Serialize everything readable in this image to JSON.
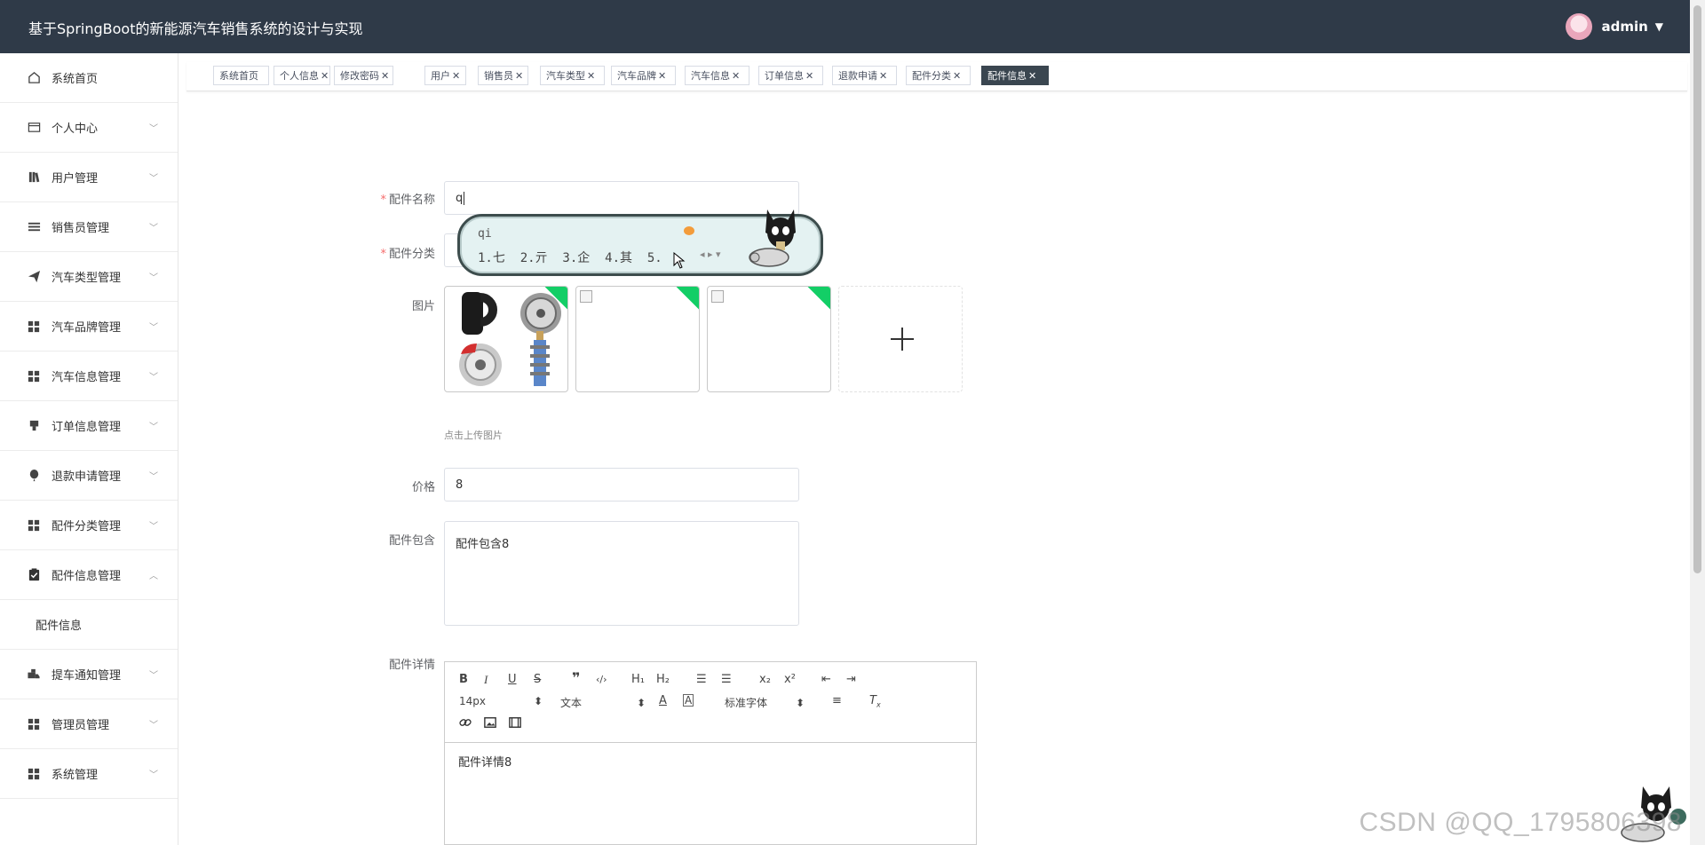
{
  "header": {
    "app_title": "基于SpringBoot的新能源汽车销售系统的设计与实现",
    "username": "admin"
  },
  "sidebar": {
    "items": [
      {
        "label": "系统首页",
        "icon": "home-icon"
      },
      {
        "label": "个人中心",
        "icon": "card-icon"
      },
      {
        "label": "用户管理",
        "icon": "users-book-icon"
      },
      {
        "label": "销售员管理",
        "icon": "list-icon"
      },
      {
        "label": "汽车类型管理",
        "icon": "send-icon"
      },
      {
        "label": "汽车品牌管理",
        "icon": "grid-icon"
      },
      {
        "label": "汽车信息管理",
        "icon": "grid-icon"
      },
      {
        "label": "订单信息管理",
        "icon": "stamp-icon"
      },
      {
        "label": "退款申请管理",
        "icon": "balloon-icon"
      },
      {
        "label": "配件分类管理",
        "icon": "grid-icon"
      },
      {
        "label": "配件信息管理",
        "icon": "clipboard-check-icon"
      },
      {
        "label": "提车通知管理",
        "icon": "truck-icon"
      },
      {
        "label": "管理员管理",
        "icon": "grid-icon"
      },
      {
        "label": "系统管理",
        "icon": "grid-icon"
      }
    ],
    "sub_item": "配件信息"
  },
  "tabs": [
    {
      "label": "系统首页"
    },
    {
      "label": "个人信息"
    },
    {
      "label": "修改密码"
    },
    {
      "label": "用户"
    },
    {
      "label": "销售员"
    },
    {
      "label": "汽车类型"
    },
    {
      "label": "汽车品牌"
    },
    {
      "label": "汽车信息"
    },
    {
      "label": "订单信息"
    },
    {
      "label": "退款申请"
    },
    {
      "label": "配件分类"
    },
    {
      "label": "配件信息"
    }
  ],
  "form": {
    "name_label": "配件名称",
    "name_value": "q",
    "category_label": "配件分类",
    "image_label": "图片",
    "upload_hint": "点击上传图片",
    "price_label": "价格",
    "price_value": "8",
    "contents_label": "配件包含",
    "contents_value": "配件包含8",
    "details_label": "配件详情",
    "details_value": "配件详情8"
  },
  "editor": {
    "font_size": "14px",
    "paragraph": "文本",
    "font_family": "标准字体"
  },
  "ime": {
    "composition": "qi",
    "candidates": "1.七  2.亓  3.企  4.其  5."
  },
  "watermark": "CSDN @QQ_1795806398"
}
